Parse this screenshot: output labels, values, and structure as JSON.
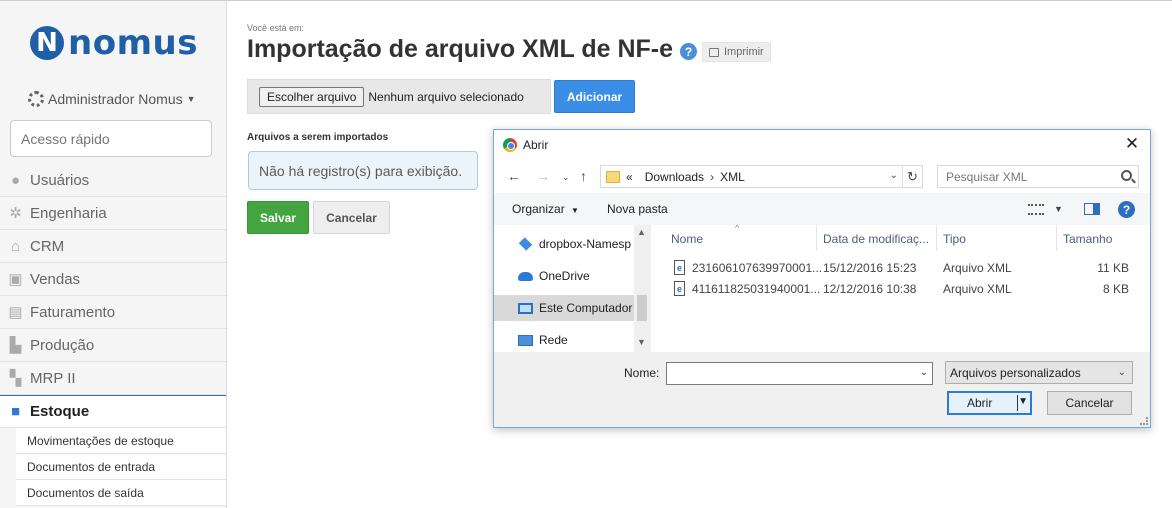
{
  "brand": {
    "logo_letter": "N",
    "logo_text": "nomus"
  },
  "user": {
    "name": "Administrador Nomus"
  },
  "quick_access": {
    "placeholder": "Acesso rápido"
  },
  "sidebar": {
    "items": [
      {
        "label": "Usuários",
        "icon": "user-icon"
      },
      {
        "label": "Engenharia",
        "icon": "gear-icon"
      },
      {
        "label": "CRM",
        "icon": "home-icon"
      },
      {
        "label": "Vendas",
        "icon": "register-icon"
      },
      {
        "label": "Faturamento",
        "icon": "invoice-icon"
      },
      {
        "label": "Produção",
        "icon": "factory-icon"
      },
      {
        "label": "MRP II",
        "icon": "blocks-icon"
      },
      {
        "label": "Estoque",
        "icon": "folder-icon"
      }
    ],
    "subitems": [
      {
        "label": "Movimentações de estoque"
      },
      {
        "label": "Documentos de entrada"
      },
      {
        "label": "Documentos de saída"
      }
    ]
  },
  "page": {
    "breadcrumb": "Você está em:",
    "title": "Importação de arquivo XML de NF-e",
    "print_label": "Imprimir",
    "choose_label": "Escolher arquivo",
    "no_file_label": "Nenhum arquivo selecionado",
    "add_label": "Adicionar",
    "files_label": "Arquivos a serem importados",
    "empty_message": "Não há registro(s) para exibição.",
    "save_label": "Salvar",
    "cancel_label": "Cancelar"
  },
  "dialog": {
    "title": "Abrir",
    "path": {
      "prefix": "«",
      "parts": [
        "Downloads",
        "XML"
      ]
    },
    "search_placeholder": "Pesquisar XML",
    "organize_label": "Organizar",
    "new_folder_label": "Nova pasta",
    "nav_items": [
      {
        "label": "dropbox-Namesp"
      },
      {
        "label": "OneDrive"
      },
      {
        "label": "Este Computador"
      },
      {
        "label": "Rede"
      }
    ],
    "columns": {
      "name": "Nome",
      "date": "Data de modificaç...",
      "type": "Tipo",
      "size": "Tamanho"
    },
    "files": [
      {
        "name": "231606107639970001...",
        "date": "15/12/2016 15:23",
        "type": "Arquivo XML",
        "size": "11 KB"
      },
      {
        "name": "411611825031940001...",
        "date": "12/12/2016 10:38",
        "type": "Arquivo XML",
        "size": "8 KB"
      }
    ],
    "name_label": "Nome:",
    "name_value": "",
    "filter_value": "Arquivos personalizados",
    "open_label": "Abrir",
    "cancel_label": "Cancelar"
  }
}
